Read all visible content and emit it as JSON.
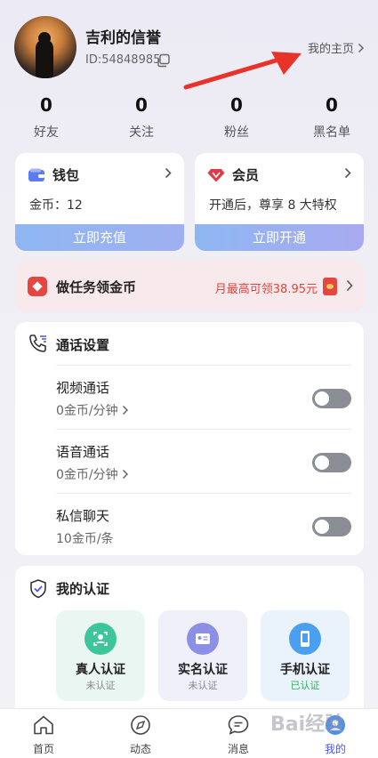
{
  "profile": {
    "name": "吉利的信誉",
    "id": "ID:54848985",
    "homepage_label": "我的主页"
  },
  "stats": [
    {
      "value": "0",
      "label": "好友"
    },
    {
      "value": "0",
      "label": "关注"
    },
    {
      "value": "0",
      "label": "粉丝"
    },
    {
      "value": "0",
      "label": "黑名单"
    }
  ],
  "wallet": {
    "title": "钱包",
    "balance": "金币：12",
    "button": "立即充值"
  },
  "member": {
    "title": "会员",
    "desc": "开通后，尊享 8 大特权",
    "button": "立即开通"
  },
  "task": {
    "title": "做任务领金币",
    "reward": "月最高可领38.95元"
  },
  "call_settings": {
    "title": "通话设置",
    "rows": [
      {
        "label": "视频通话",
        "sub": "0金币/分钟",
        "has_chevron": true,
        "enabled": false
      },
      {
        "label": "语音通话",
        "sub": "0金币/分钟",
        "has_chevron": true,
        "enabled": false
      },
      {
        "label": "私信聊天",
        "sub": "10金币/条",
        "has_chevron": false,
        "enabled": false
      }
    ]
  },
  "auth": {
    "title": "我的认证",
    "items": [
      {
        "title": "真人认证",
        "status": "未认证",
        "color": "#3cc69a",
        "bg": "#eaf6f1",
        "status_color": "#888888"
      },
      {
        "title": "实名认证",
        "status": "未认证",
        "color": "#8c8fe6",
        "bg": "#eff0fa",
        "status_color": "#888888"
      },
      {
        "title": "手机认证",
        "status": "已认证",
        "color": "#4a9ff0",
        "bg": "#eaf3fb",
        "status_color": "#2bb05a"
      }
    ]
  },
  "tabs": [
    {
      "label": "首页",
      "icon": "home-icon"
    },
    {
      "label": "动态",
      "icon": "compass-icon"
    },
    {
      "label": "消息",
      "icon": "message-icon"
    },
    {
      "label": "我的",
      "icon": "profile-icon",
      "active": true
    }
  ],
  "watermark": "Bai经验"
}
